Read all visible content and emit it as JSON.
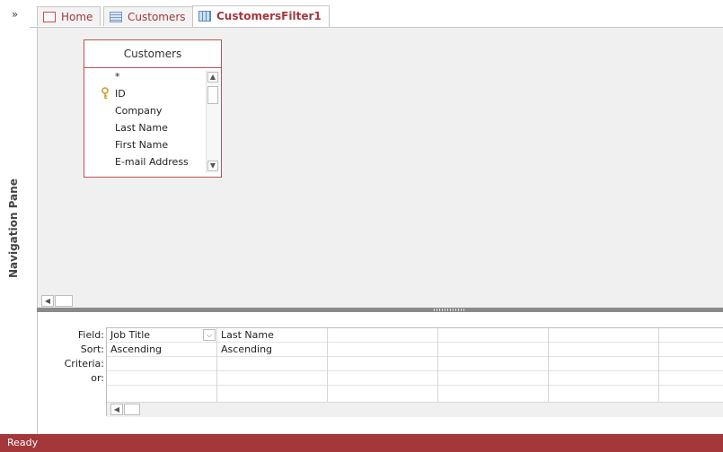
{
  "nav_pane": {
    "toggle_glyph": "»",
    "label": "Navigation Pane"
  },
  "tabs": [
    {
      "label": "Home",
      "icon": "form-icon"
    },
    {
      "label": "Customers",
      "icon": "table-icon"
    },
    {
      "label": "CustomersFilter1",
      "icon": "query-icon",
      "active": true
    }
  ],
  "table_box": {
    "title": "Customers",
    "fields": [
      "*",
      "ID",
      "Company",
      "Last Name",
      "First Name",
      "E-mail Address"
    ],
    "primary_key": "ID"
  },
  "design_grid": {
    "row_labels": [
      "Field:",
      "Sort:",
      "Criteria:",
      "or:"
    ],
    "columns": [
      {
        "field": "Job Title",
        "sort": "Ascending",
        "criteria": "",
        "or": ""
      },
      {
        "field": "Last Name",
        "sort": "Ascending",
        "criteria": "",
        "or": ""
      },
      {
        "field": "",
        "sort": "",
        "criteria": "",
        "or": ""
      },
      {
        "field": "",
        "sort": "",
        "criteria": "",
        "or": ""
      },
      {
        "field": "",
        "sort": "",
        "criteria": "",
        "or": ""
      },
      {
        "field": "",
        "sort": "",
        "criteria": "",
        "or": ""
      }
    ]
  },
  "status": {
    "text": "Ready"
  },
  "colors": {
    "accent": "#a4373a",
    "table_border": "#c0504d",
    "pane_bg": "#f0f0f0"
  }
}
